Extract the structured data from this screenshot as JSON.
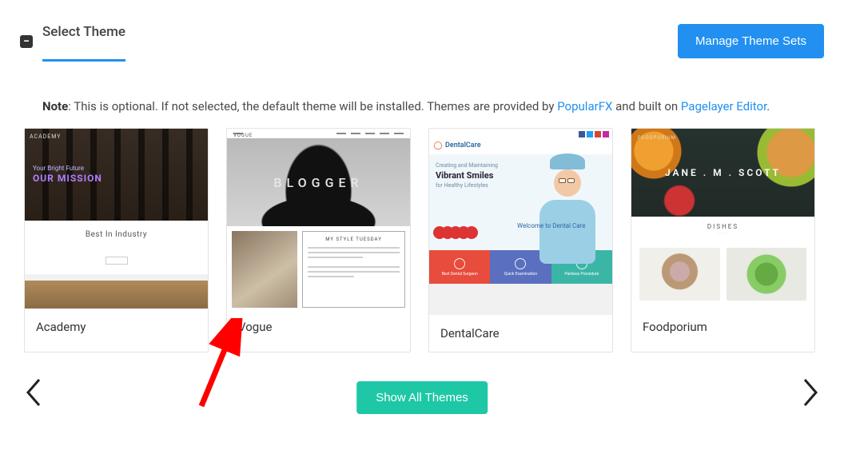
{
  "section": {
    "title": "Select Theme",
    "collapse_symbol": "−"
  },
  "buttons": {
    "manage": "Manage Theme Sets",
    "show_all": "Show All Themes"
  },
  "note": {
    "bold": "Note",
    "before": ": This is optional. If not selected, the default theme will be installed. Themes are provided by ",
    "link1": "PopularFX",
    "mid": " and built on ",
    "link2": "Pagelayer Editor",
    "after": "."
  },
  "themes": [
    {
      "name": "Academy",
      "preview": {
        "brand": "ACADEMY",
        "tagline": "Your Bright Future",
        "mission": "OUR MISSION",
        "mid_title": "Best In Industry"
      }
    },
    {
      "name": "Vogue",
      "preview": {
        "logo": "VOGUE",
        "hero_text": "BLOGGER",
        "col_title": "MY STYLE TUESDAY"
      }
    },
    {
      "name": "DentalCare",
      "preview": {
        "brand": "DentalCare",
        "h1": "Creating and Maintaining",
        "h2": "Vibrant Smiles",
        "h3": "for Healthy Lifestyles",
        "welcome": "Welcome to Dental Care",
        "f1": "Best Dental Surgeon",
        "f2": "Quick Examination",
        "f3": "Painless Procedure"
      }
    },
    {
      "name": "Foodporium",
      "preview": {
        "brand": "FOODPORIUM",
        "jane": "JANE . M . SCOTT",
        "mid_title": "DISHES"
      }
    }
  ]
}
